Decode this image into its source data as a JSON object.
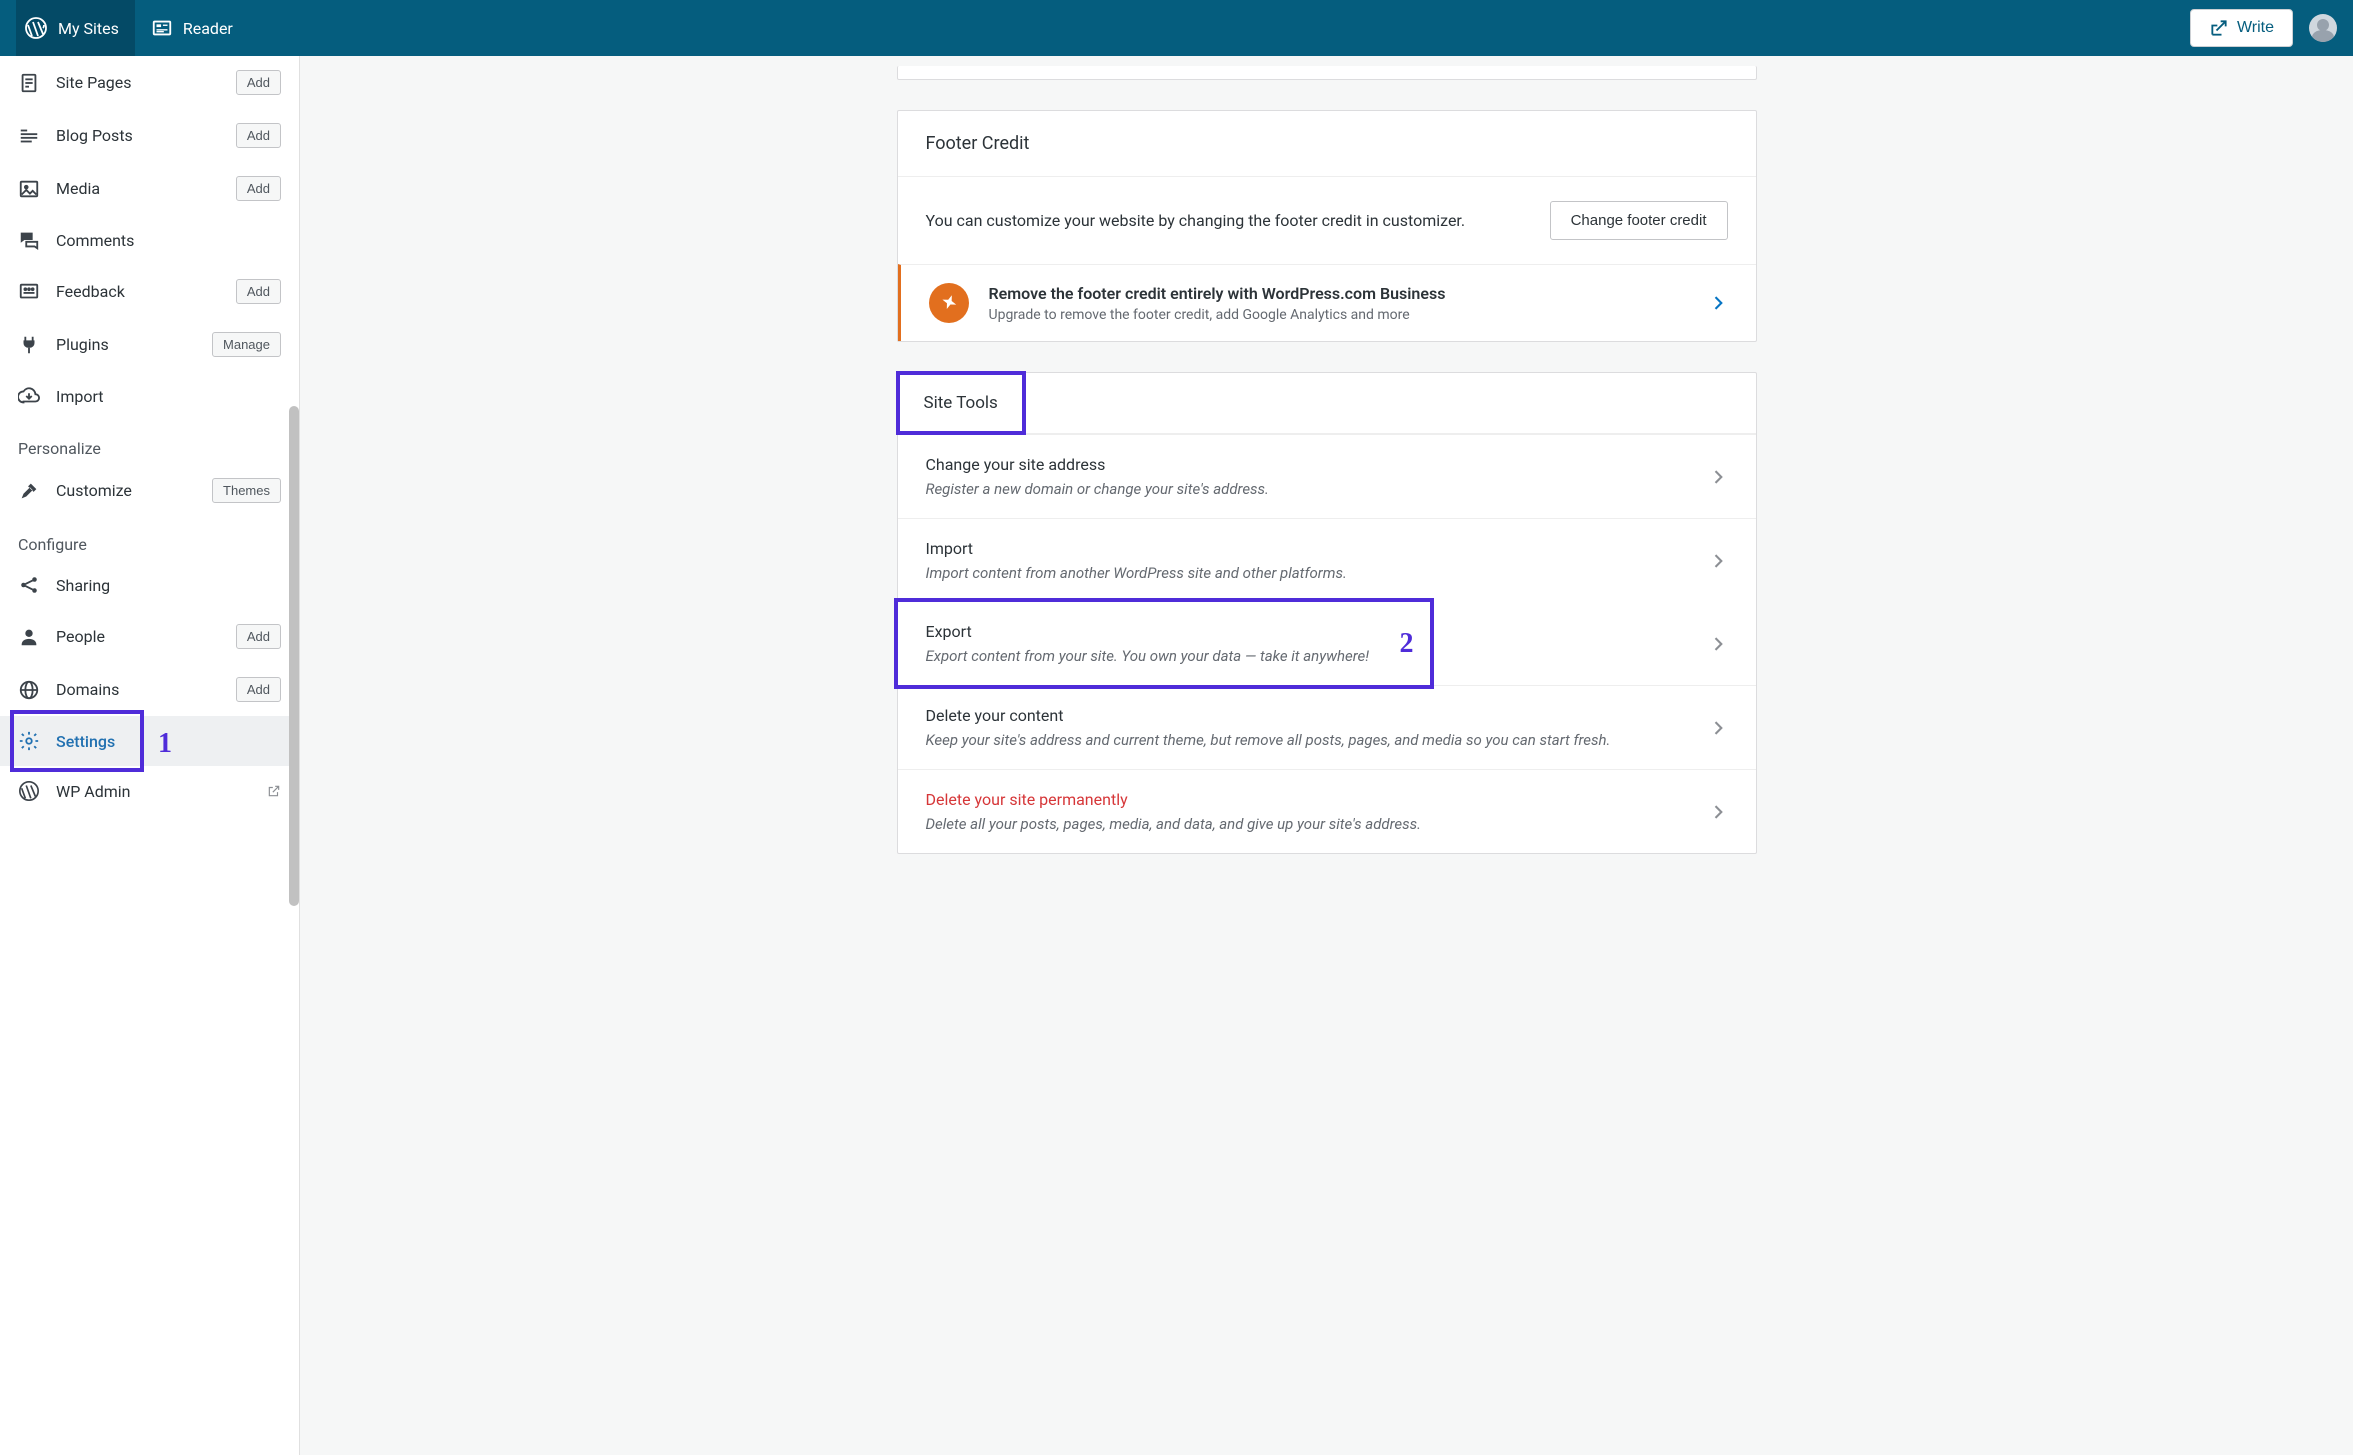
{
  "topbar": {
    "my_sites": "My Sites",
    "reader": "Reader",
    "write": "Write"
  },
  "sidebar": {
    "items": [
      {
        "label": "Site Pages",
        "action": "Add"
      },
      {
        "label": "Blog Posts",
        "action": "Add"
      },
      {
        "label": "Media",
        "action": "Add"
      },
      {
        "label": "Comments",
        "action": ""
      },
      {
        "label": "Feedback",
        "action": "Add"
      },
      {
        "label": "Plugins",
        "action": "Manage"
      },
      {
        "label": "Import",
        "action": ""
      }
    ],
    "personalize_header": "Personalize",
    "customize": {
      "label": "Customize",
      "action": "Themes"
    },
    "configure_header": "Configure",
    "configure": [
      {
        "label": "Sharing",
        "action": ""
      },
      {
        "label": "People",
        "action": "Add"
      },
      {
        "label": "Domains",
        "action": "Add"
      },
      {
        "label": "Settings",
        "action": ""
      },
      {
        "label": "WP Admin",
        "action": ""
      }
    ]
  },
  "annotations": {
    "one": "1",
    "two": "2"
  },
  "footer_credit": {
    "header": "Footer Credit",
    "body": "You can customize your website by changing the footer credit in customizer.",
    "button": "Change footer credit",
    "upsell_title": "Remove the footer credit entirely with WordPress.com Business",
    "upsell_sub": "Upgrade to remove the footer credit, add Google Analytics and more"
  },
  "site_tools": {
    "header": "Site Tools",
    "rows": [
      {
        "title": "Change your site address",
        "sub": "Register a new domain or change your site's address."
      },
      {
        "title": "Import",
        "sub": "Import content from another WordPress site and other platforms."
      },
      {
        "title": "Export",
        "sub": "Export content from your site. You own your data — take it anywhere!"
      },
      {
        "title": "Delete your content",
        "sub": "Keep your site's address and current theme, but remove all posts, pages, and media so you can start fresh."
      },
      {
        "title": "Delete your site permanently",
        "sub": "Delete all your posts, pages, media, and data, and give up your site's address."
      }
    ]
  }
}
